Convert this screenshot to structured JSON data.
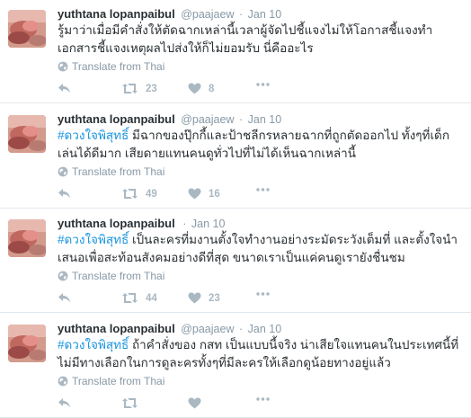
{
  "colors": {
    "hashtag": "#1b95e0",
    "meta": "#8899a6",
    "action_icon": "#aab8c2",
    "divider": "#e1e8ed"
  },
  "icons": {
    "globe": "globe-icon",
    "reply": "reply-icon",
    "retweet": "retweet-icon",
    "like": "heart-icon",
    "more": "more-dots-icon"
  },
  "tweets": [
    {
      "fullname": "yuthtana lopanpaibul",
      "handle": "@paajaew",
      "separator": "·",
      "time": "Jan 10",
      "hashtag": "",
      "text": "รู้มาว่าเมื่อมีคำสั่งให้ตัดฉากเหล่านี้เวลาผู้จัดไปชี้แจงไม่ให้โอกาสชี้แจงทำเอกสารชี้แจงเหตุผลไปส่งให้ก็ไม่ยอมรับ นี่คืออะไร",
      "translate_label": "Translate from Thai",
      "retweets": "23",
      "likes": "8"
    },
    {
      "fullname": "yuthtana lopanpaibul",
      "handle": "@paajaew",
      "separator": "·",
      "time": "Jan 10",
      "hashtag": "#ดวงใจพิสุทธิ์",
      "text": " มีฉากของปุ๊กกี้และป้าชลีกรหลายฉากที่ถูกตัดออกไป ทั้งๆที่เด็กเล่นได้ดีมาก เสียดายแทนคนดูทั่วไปที่ไม่ได้เห็นฉากเหล่านี้",
      "translate_label": "Translate from Thai",
      "retweets": "49",
      "likes": "16"
    },
    {
      "fullname": "yuthtana lopanpaibul",
      "handle": "",
      "separator": "·",
      "time": "Jan 10",
      "hashtag": "#ดวงใจพิสุทธิ์",
      "text": " เป็นละครที่มงานตั้งใจทำงานอย่างระมัดระวังเต็มที่ และตั้งใจนำเสนอเพื่อสะท้อนสังคมอย่างดีที่สุด ขนาดเราเป็นแค่คนดูเรายังชื่นชม",
      "translate_label": "Translate from Thai",
      "retweets": "44",
      "likes": "23"
    },
    {
      "fullname": "yuthtana lopanpaibul",
      "handle": "@paajaew",
      "separator": "·",
      "time": "Jan 10",
      "hashtag": "#ดวงใจพิสุทธิ์",
      "text": " ถ้าคำสั่งของ กสท เป็นแบบนี้จริง น่าเสียใจแทนคนในประเทศนี้ที่ไม่มีทางเลือกในการดูละครทั้งๆที่มีละครให้เลือกดูน้อยทางอยู่แล้ว",
      "translate_label": "Translate from Thai",
      "retweets": "",
      "likes": ""
    }
  ]
}
